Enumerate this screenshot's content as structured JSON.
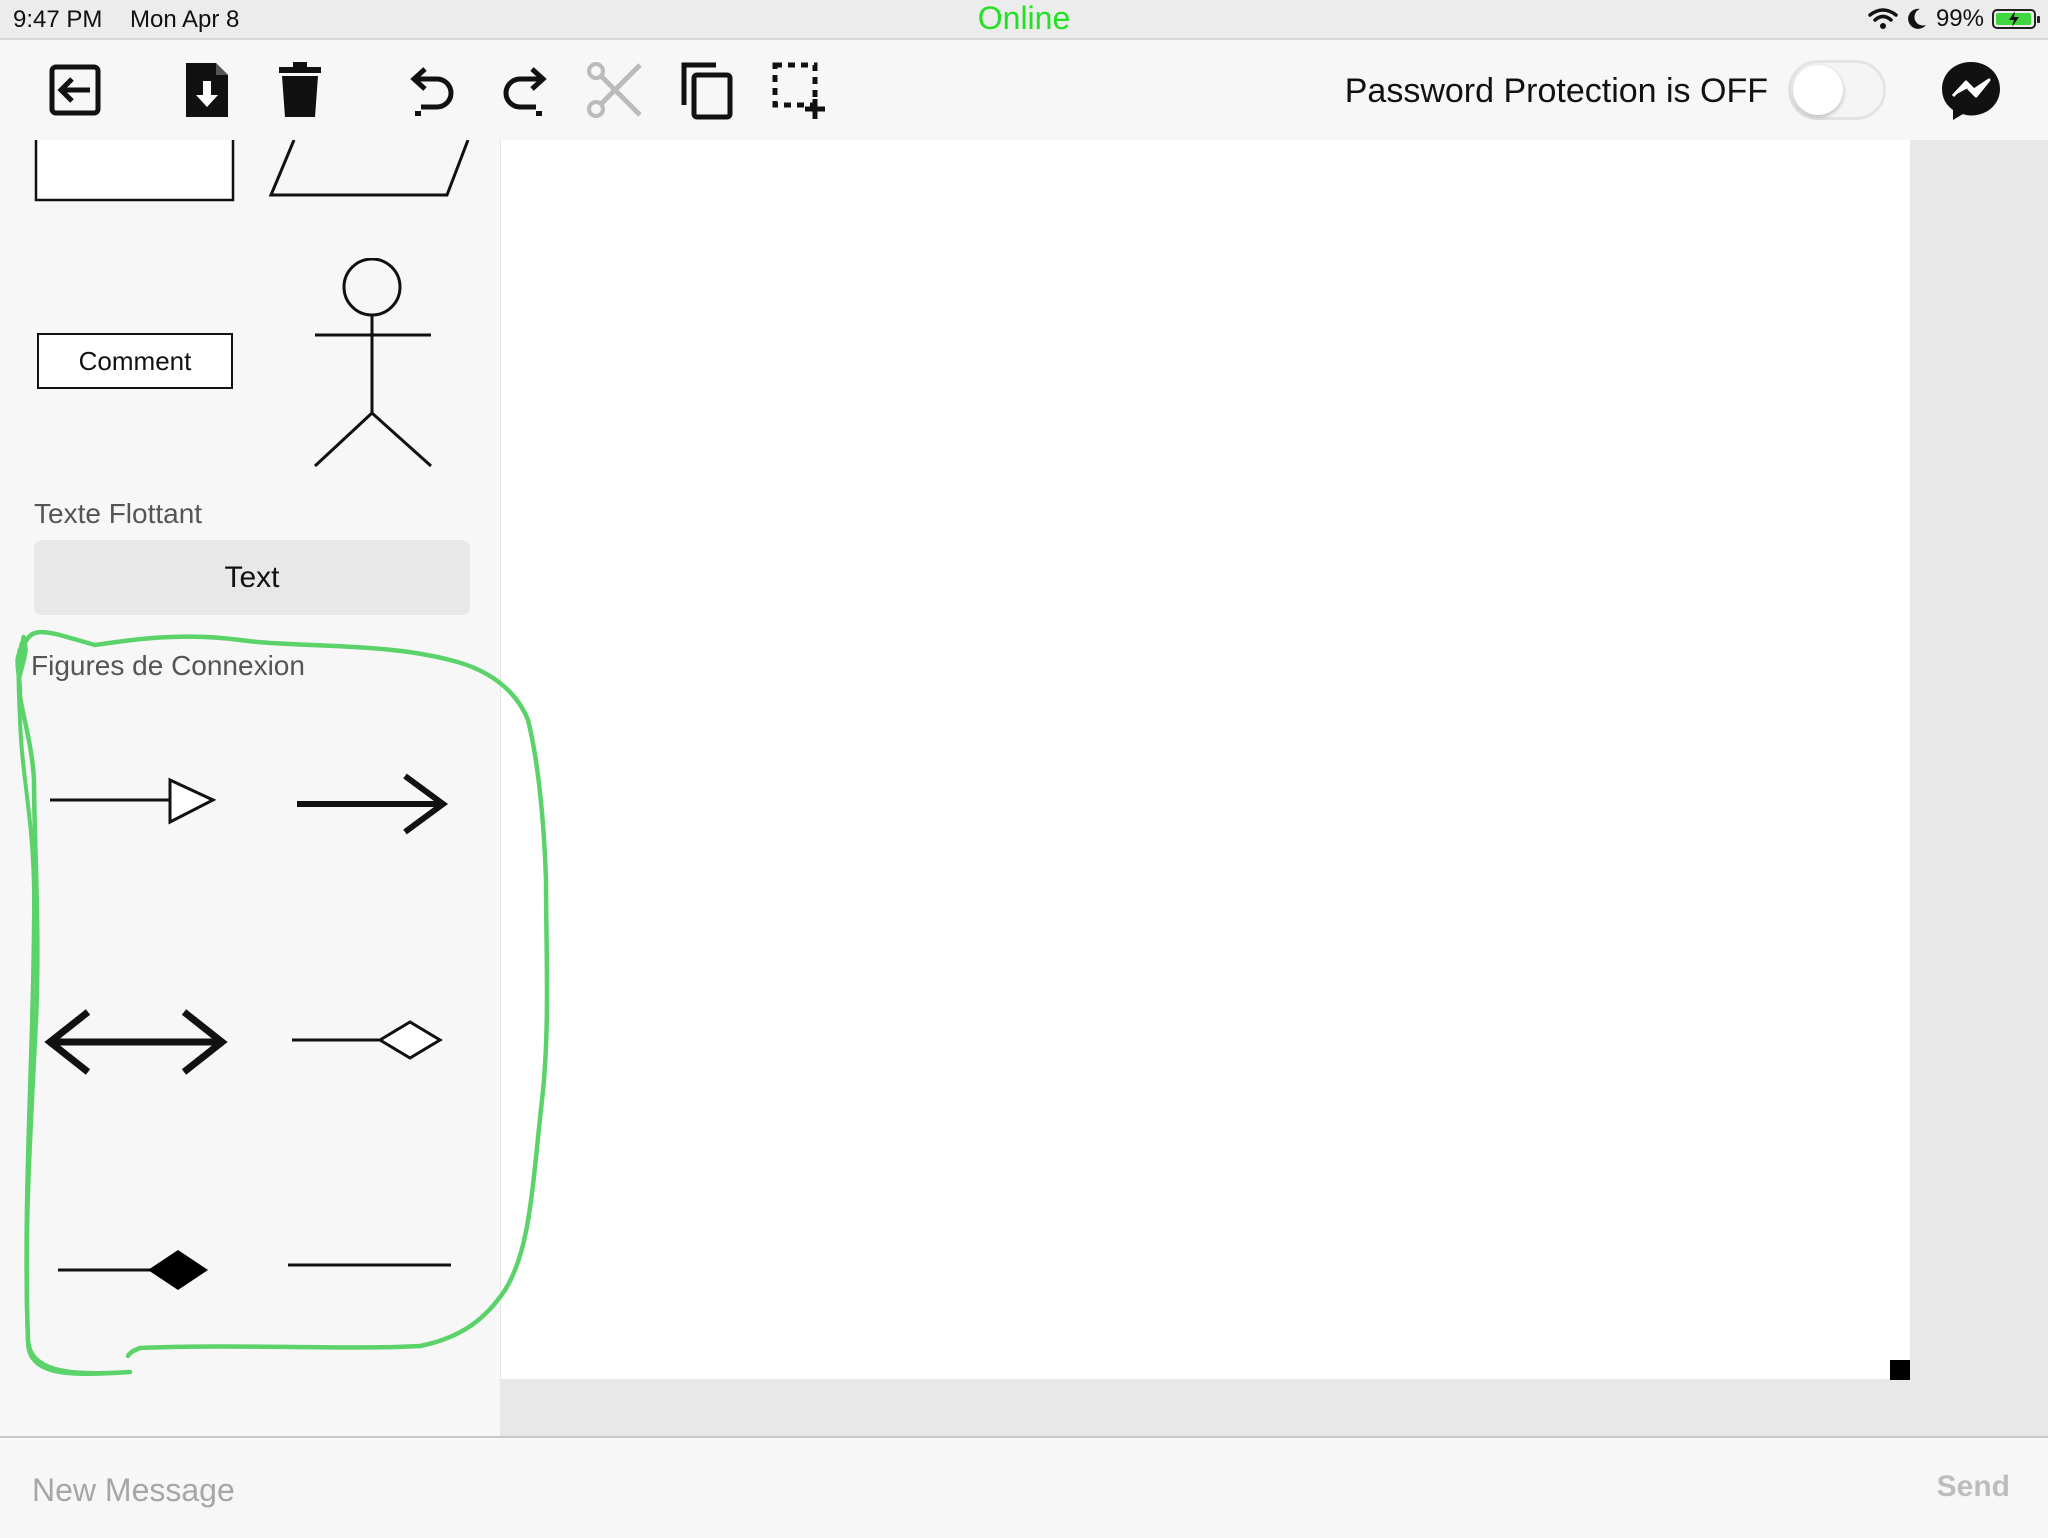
{
  "status_bar": {
    "time": "9:47 PM",
    "date": "Mon Apr 8",
    "connection": "Online",
    "battery": "99%",
    "icons": [
      "wifi-icon",
      "moon-icon",
      "battery-charging-icon"
    ]
  },
  "toolbar": {
    "buttons": [
      {
        "name": "exit-icon"
      },
      {
        "name": "save-download-icon"
      },
      {
        "name": "trash-icon"
      },
      {
        "name": "undo-icon"
      },
      {
        "name": "redo-icon"
      },
      {
        "name": "cut-scissors-icon",
        "disabled": true
      },
      {
        "name": "copy-icon"
      },
      {
        "name": "select-add-icon"
      }
    ],
    "password_label": "Password Protection is OFF",
    "password_toggle_on": false,
    "messenger_icon": "messenger-icon"
  },
  "sidebar": {
    "comment_label": "Comment",
    "floating_text_section": "Texte Flottant",
    "text_button": "Text",
    "connection_section": "Figures de Connexion",
    "connectors": [
      "open-triangle-arrow",
      "open-arrow",
      "double-arrow",
      "open-diamond-line",
      "filled-diamond-line",
      "plain-line"
    ]
  },
  "message_bar": {
    "placeholder": "New Message",
    "send_label": "Send"
  },
  "colors": {
    "online": "#22e022",
    "annotation": "#5bd36a",
    "battery": "#3fd63f",
    "send_disabled": "#bdbdbd"
  }
}
